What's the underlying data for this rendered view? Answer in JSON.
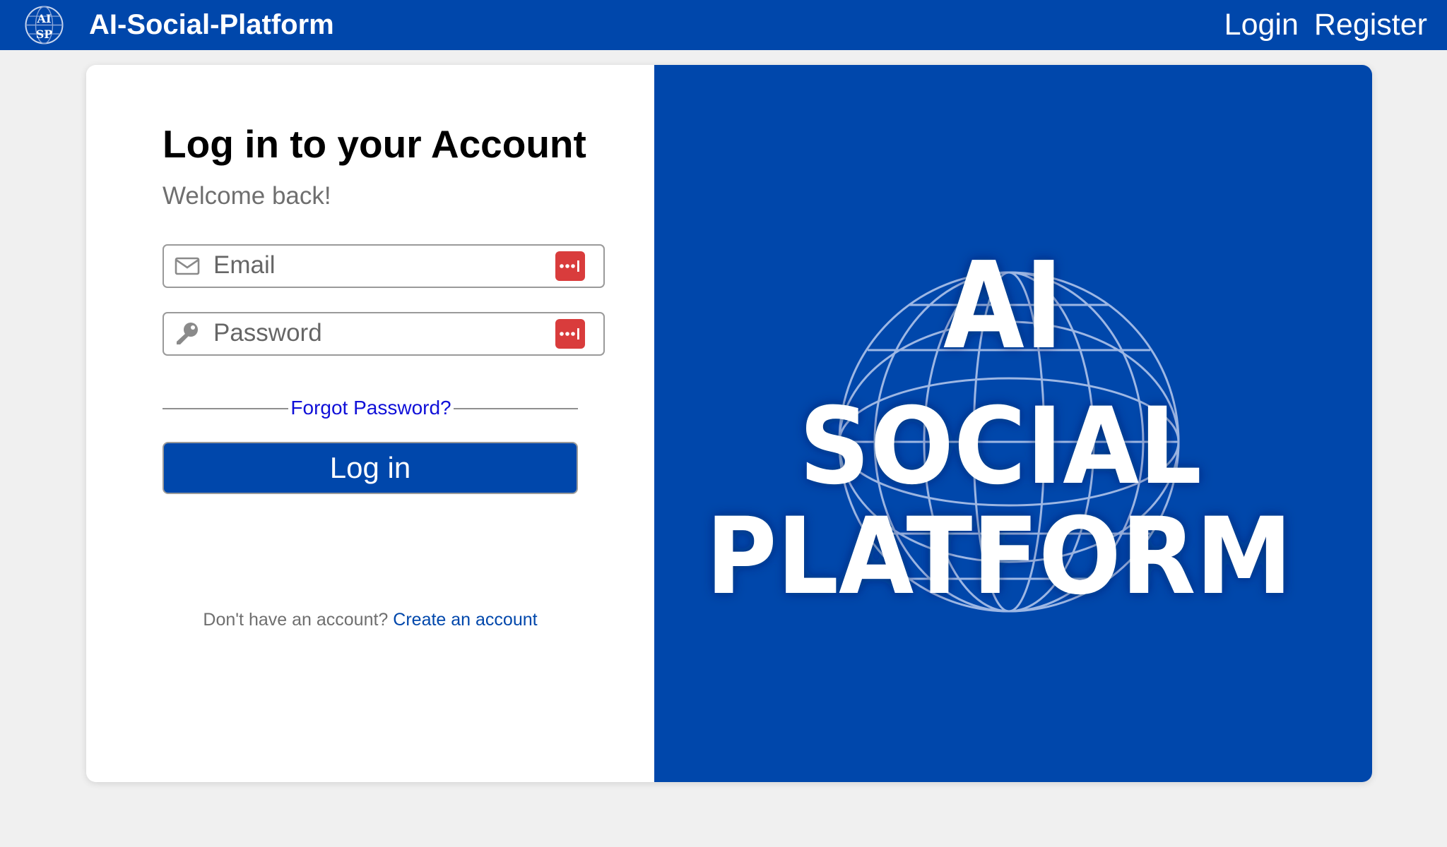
{
  "navbar": {
    "logo_text_top": "AI",
    "logo_text_bottom": "SP",
    "brand": "AI-Social-Platform",
    "links": [
      {
        "label": "Login"
      },
      {
        "label": "Register"
      }
    ]
  },
  "login_form": {
    "title": "Log in to your Account",
    "subtitle": "Welcome back!",
    "email": {
      "icon": "envelope-icon",
      "placeholder": "Email",
      "value": ""
    },
    "password": {
      "icon": "key-icon",
      "placeholder": "Password",
      "value": ""
    },
    "password_manager_icon": "password-manager-icon",
    "forgot_password": "Forgot Password?",
    "submit_label": "Log in",
    "signup_prompt": "Don't have an account?",
    "signup_link": "Create an account"
  },
  "hero": {
    "line1": "AI",
    "line2": "SOCIAL",
    "line3": "PLATFORM"
  },
  "colors": {
    "primary": "#0047ab",
    "page_background": "#f0f0f0",
    "password_manager": "#d93c3c",
    "link_blue": "#1010d8",
    "muted_text": "#6f6f6f"
  }
}
